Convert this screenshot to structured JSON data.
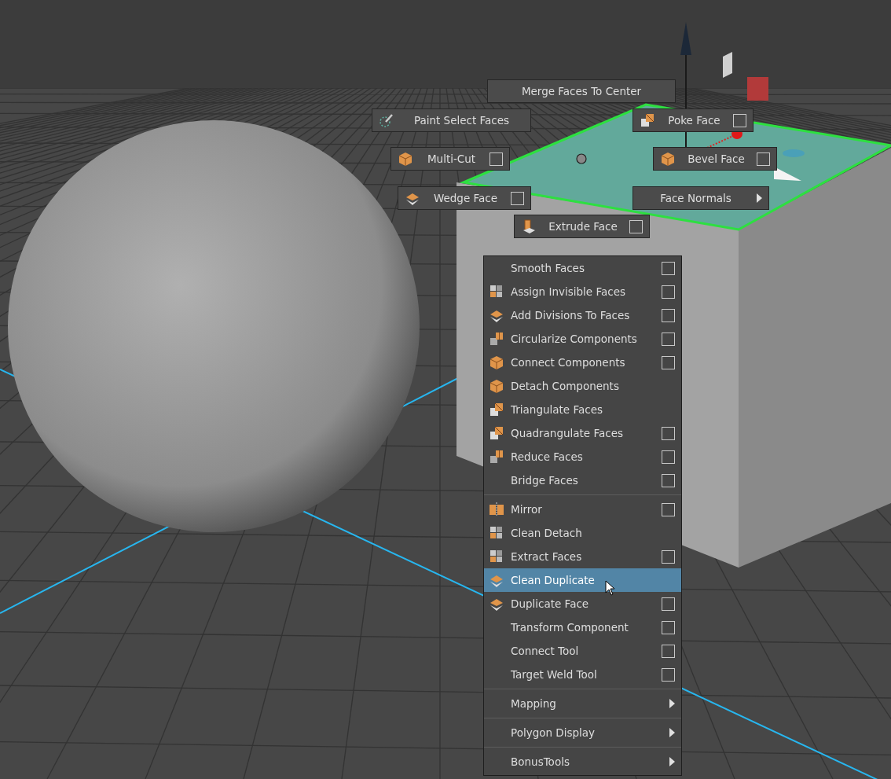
{
  "viewport": {
    "marking_menu": [
      {
        "label": "Merge Faces To Center",
        "kind": "plain"
      },
      {
        "label": "Paint Select Faces",
        "kind": "plain"
      },
      {
        "label": "Poke Face",
        "kind": "option"
      },
      {
        "label": "Multi-Cut",
        "kind": "option"
      },
      {
        "label": "Bevel Face",
        "kind": "option"
      },
      {
        "label": "Wedge Face",
        "kind": "option"
      },
      {
        "label": "Face Normals",
        "kind": "submenu"
      },
      {
        "label": "Extrude Face",
        "kind": "option"
      }
    ],
    "context_menu": {
      "sections": [
        {
          "items": [
            {
              "label": "Smooth Faces",
              "kind": "option",
              "selected": false
            },
            {
              "label": "Assign Invisible Faces",
              "kind": "option",
              "selected": false
            },
            {
              "label": "Add Divisions To Faces",
              "kind": "option",
              "selected": false
            },
            {
              "label": "Circularize Components",
              "kind": "option",
              "selected": false
            },
            {
              "label": "Connect Components",
              "kind": "option",
              "selected": false
            },
            {
              "label": "Detach Components",
              "kind": "plain",
              "selected": false
            },
            {
              "label": "Triangulate Faces",
              "kind": "plain",
              "selected": false
            },
            {
              "label": "Quadrangulate Faces",
              "kind": "option",
              "selected": false
            },
            {
              "label": "Reduce Faces",
              "kind": "option",
              "selected": false
            },
            {
              "label": "Bridge Faces",
              "kind": "option",
              "selected": false
            }
          ]
        },
        {
          "items": [
            {
              "label": "Mirror",
              "kind": "option",
              "selected": false
            },
            {
              "label": "Clean Detach",
              "kind": "plain",
              "selected": false
            },
            {
              "label": "Extract Faces",
              "kind": "option",
              "selected": false
            },
            {
              "label": "Clean Duplicate",
              "kind": "plain",
              "selected": true
            },
            {
              "label": "Duplicate Face",
              "kind": "option",
              "selected": false
            },
            {
              "label": "Transform Component",
              "kind": "option",
              "selected": false
            },
            {
              "label": "Connect Tool",
              "kind": "option",
              "selected": false
            },
            {
              "label": "Target Weld Tool",
              "kind": "option",
              "selected": false
            }
          ]
        },
        {
          "items": [
            {
              "label": "Mapping",
              "kind": "submenu",
              "selected": false
            }
          ]
        },
        {
          "items": [
            {
              "label": "Polygon Display",
              "kind": "submenu",
              "selected": false
            }
          ]
        },
        {
          "items": [
            {
              "label": "BonusTools",
              "kind": "submenu",
              "selected": false
            }
          ]
        }
      ]
    }
  }
}
